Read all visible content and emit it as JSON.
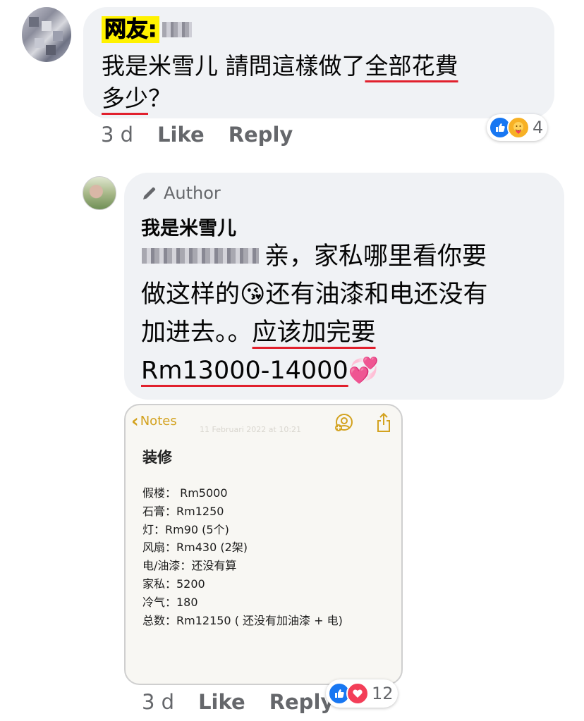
{
  "comment": {
    "author_label": "网友:",
    "text_plain": "我是米雪儿 請問這樣做了",
    "text_underlined_1": "全部花費",
    "text_underlined_2": "多少",
    "text_tail": "？",
    "time": "3 d",
    "like_label": "Like",
    "reply_label": "Reply",
    "reactions": {
      "icons": [
        "like-icon",
        "care-icon"
      ],
      "count": "4"
    }
  },
  "reply": {
    "author_badge": "Author",
    "author_name": "我是米雪儿",
    "line1_tail": "亲，家私哪里看你要",
    "line2_head": "做这样的",
    "line2_emoji": "😘",
    "line2_tail": "还有油漆和电还没有",
    "line3_plain": "加进去。。",
    "line3_underlined": "应该加完要",
    "line4_underlined": "Rm13000-14000",
    "line4_emoji": "💞",
    "time": "3 d",
    "like_label": "Like",
    "reply_label": "Reply",
    "reactions": {
      "icons": [
        "like-icon",
        "love-icon"
      ],
      "count": "12"
    }
  },
  "notes": {
    "back_label": "Notes",
    "faint_timestamp": "11 Februari 2022 at 10:21",
    "title": "装修",
    "items": [
      "假楼： Rm5000",
      "石膏：Rm1250",
      "灯：Rm90 (5个)",
      "风扇：Rm430 (2架)",
      "电/油漆：还没有算",
      "家私：5200",
      "冷气：180",
      "总数：Rm12150 ( 还没有加油漆 + 电)"
    ]
  },
  "colors": {
    "bubble": "#f0f2f5",
    "underline": "#e1202d",
    "highlight": "#fff200",
    "meta_text": "#65676b",
    "like_blue": "#1877f2",
    "love_red": "#f33e58",
    "notes_accent": "#d3a21f"
  }
}
